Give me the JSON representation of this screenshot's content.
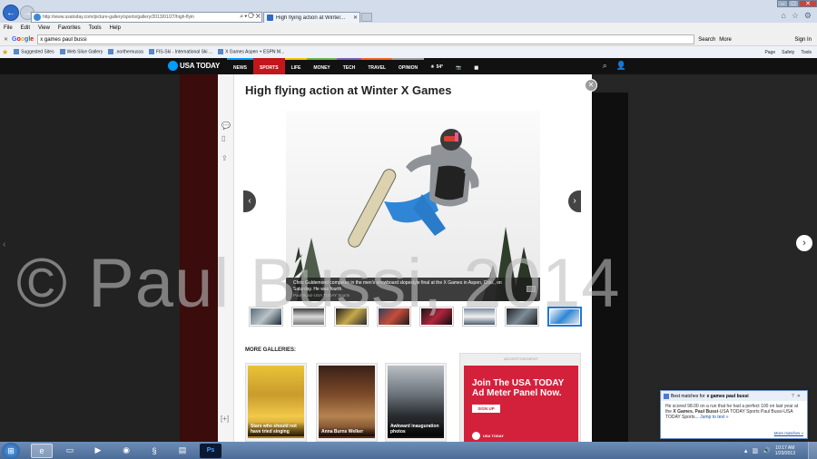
{
  "browser": {
    "url": "http://www.usatoday.com/picture-gallery/sports/gallery/2013/01/27/high-flyin",
    "tab_title": "High flying action at Winter...",
    "menu": [
      "File",
      "Edit",
      "View",
      "Favorites",
      "Tools",
      "Help"
    ],
    "google_query": "x games paul bussi",
    "google_search_label": "Search",
    "google_more_label": "More",
    "google_signin_label": "Sign In",
    "favorites": [
      "Suggested Sites",
      "Web Slice Gallery",
      ".northernussa",
      "FIS-Ski - International Ski ...",
      "X Games Aspen + ESPN M..."
    ],
    "command_bar": [
      "Page",
      "Safety",
      "Tools"
    ]
  },
  "site": {
    "logo": "USA TODAY",
    "nav": [
      "NEWS",
      "SPORTS",
      "LIFE",
      "MONEY",
      "TECH",
      "TRAVEL",
      "OPINION"
    ],
    "nav_colors": [
      "#0098fe",
      "#c2171c",
      "#f9c600",
      "#6fb54b",
      "#7f5fb4",
      "#f0641e",
      "#9b9b9b"
    ],
    "weather": "54°"
  },
  "gallery": {
    "title": "High flying action at Winter X Games",
    "caption": "Chris Guldemond competes in the men's snowboard slopestyle final at the X Games in Aspen, Colo., on Saturday. He was fourth.",
    "credit": "Paul Bussi-USA TODAY Sports",
    "thumbnails": 8,
    "selected_thumbnail": 8,
    "more_heading": "MORE GALLERIES:",
    "more_galleries": [
      {
        "label": "Stars who should not have tried singing"
      },
      {
        "label": "Anna Burns Welker"
      },
      {
        "label": "Awkward inauguration photos"
      }
    ]
  },
  "ad": {
    "label": "ADVERTISEMENT",
    "headline": "Join The USA TODAY Ad Meter Panel Now.",
    "cta": "SIGN UP",
    "logo": "USA TODAY"
  },
  "watermark": "© Paul Bussi, 2014",
  "notification": {
    "title_prefix": "Best matches for",
    "title_query": "x games paul bussi",
    "body_1": "He scored 98.00 on a run that he had a perfect 100 on last year at the",
    "body_bold_1": "X Games.",
    "body_bold_2": "Paul Bussi",
    "body_2": "-USA TODAY Sports Paul Bussi-USA TODAY Sports...",
    "jump": "Jump to text »",
    "more": "More matches »"
  },
  "taskbar": {
    "time": "10:17 AM",
    "date": "1/29/2013"
  }
}
